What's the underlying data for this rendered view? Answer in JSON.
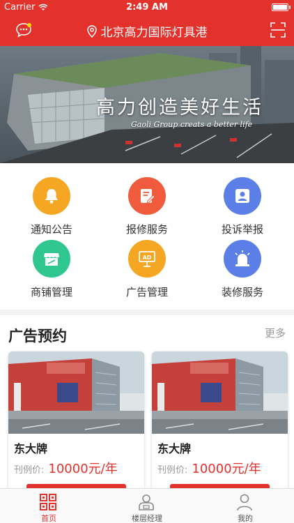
{
  "status_bar": {
    "carrier": "Carrier",
    "time": "2:49 AM"
  },
  "header": {
    "location": "北京高力国际灯具港"
  },
  "banner": {
    "slogan": "高力创造美好生活",
    "slogan_en": "Gaoli Group creats a better life",
    "slides_count": 2,
    "active_slide": 1
  },
  "services": [
    {
      "label": "通知公告",
      "color": "#f5a623",
      "icon": "bell-icon"
    },
    {
      "label": "报修服务",
      "color": "#ef5b3c",
      "icon": "edit-pen-icon"
    },
    {
      "label": "投诉举报",
      "color": "#5b7fe6",
      "icon": "person-report-icon"
    },
    {
      "label": "商铺管理",
      "color": "#2fc78f",
      "icon": "shop-icon"
    },
    {
      "label": "广告管理",
      "color": "#f5a623",
      "icon": "ad-board-icon"
    },
    {
      "label": "装修服务",
      "color": "#5b7fe6",
      "icon": "alarm-light-icon"
    }
  ],
  "ads": {
    "title": "广告预约",
    "more": "更多",
    "cards": [
      {
        "name": "东大牌",
        "price_label": "刊例价:",
        "price": "10000元/年"
      },
      {
        "name": "东大牌",
        "price_label": "刊例价:",
        "price": "10000元/年"
      }
    ]
  },
  "tabs": [
    {
      "label": "首页",
      "icon": "home-grid-icon",
      "active": true
    },
    {
      "label": "楼层经理",
      "icon": "manager-icon",
      "active": false
    },
    {
      "label": "我的",
      "icon": "profile-icon",
      "active": false
    }
  ],
  "colors": {
    "primary": "#e3312c",
    "background": "#f2f2f2"
  }
}
